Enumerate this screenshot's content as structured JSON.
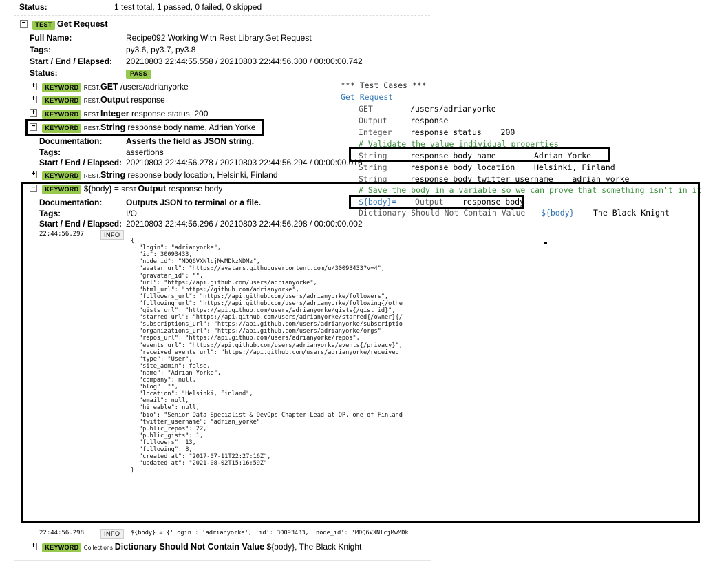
{
  "status_row": {
    "label": "Status:",
    "value": "1 test total, 1 passed, 0 failed, 0 skipped"
  },
  "test": {
    "badge": "TEST",
    "name": "Get Request",
    "full_name_label": "Full Name:",
    "full_name": "Recipe092 Working With Rest Library.Get Request",
    "tags_label": "Tags:",
    "tags": "py3.6, py3.7, py3.8",
    "elapsed_label": "Start / End / Elapsed:",
    "elapsed": "20210803 22:44:55.558 / 20210803 22:44:56.300 / 00:00:00.742",
    "status_label": "Status:",
    "status": "PASS"
  },
  "keywords": [
    {
      "badge": "KEYWORD",
      "lib": "REST.",
      "name": "GET",
      "args": " /users/adrianyorke",
      "toggle": "+"
    },
    {
      "badge": "KEYWORD",
      "lib": "REST.",
      "name": "Output",
      "args": " response",
      "toggle": "+"
    },
    {
      "badge": "KEYWORD",
      "lib": "REST.",
      "name": "Integer",
      "args": " response status, 200",
      "toggle": "+"
    },
    {
      "badge": "KEYWORD",
      "lib": "REST.",
      "name": "String",
      "args": " response body name, Adrian Yorke",
      "toggle": "−",
      "doc_label": "Documentation:",
      "doc": "Asserts the field as JSON string.",
      "tags_label": "Tags:",
      "tags": "assertions",
      "elapsed_label": "Start / End / Elapsed:",
      "elapsed": "20210803 22:44:56.278 / 20210803 22:44:56.294 / 00:00:00.016"
    },
    {
      "badge": "KEYWORD",
      "lib": "REST.",
      "name": "String",
      "args": " response body location, Helsinki, Finland",
      "toggle": "+"
    },
    {
      "badge": "KEYWORD",
      "prefix": "${body} = ",
      "lib": "REST.",
      "name": "Output",
      "args": " response body",
      "toggle": "−",
      "doc_label": "Documentation:",
      "doc": "Outputs JSON to terminal or a file.",
      "tags_label": "Tags:",
      "tags": "I/O",
      "elapsed_label": "Start / End / Elapsed:",
      "elapsed": "20210803 22:44:56.296 / 20210803 22:44:56.298 / 00:00:00.002"
    },
    {
      "badge": "KEYWORD",
      "lib": "Collections.",
      "name": "Dictionary Should Not Contain Value",
      "args": " ${body}, The Black Knight",
      "toggle": "+"
    }
  ],
  "log1": {
    "time": "22:44:56.297",
    "level": "INFO"
  },
  "json_lines": [
    "{",
    "    \"login\": \"adrianyorke\",",
    "    \"id\": 30093433,",
    "    \"node_id\": \"MDQ6VXNlcjMwMDkzNDMz\",",
    "    \"avatar_url\": \"https://avatars.githubusercontent.com/u/30093433?v=4\",",
    "    \"gravatar_id\": \"\",",
    "    \"url\": \"https://api.github.com/users/adrianyorke\",",
    "    \"html_url\": \"https://github.com/adrianyorke\",",
    "    \"followers_url\": \"https://api.github.com/users/adrianyorke/followers\",",
    "    \"following_url\": \"https://api.github.com/users/adrianyorke/following{/othe",
    "    \"gists_url\": \"https://api.github.com/users/adrianyorke/gists{/gist_id}\",",
    "    \"starred_url\": \"https://api.github.com/users/adrianyorke/starred{/owner}{/",
    "    \"subscriptions_url\": \"https://api.github.com/users/adrianyorke/subscriptio",
    "    \"organizations_url\": \"https://api.github.com/users/adrianyorke/orgs\",",
    "    \"repos_url\": \"https://api.github.com/users/adrianyorke/repos\",",
    "    \"events_url\": \"https://api.github.com/users/adrianyorke/events{/privacy}\",",
    "    \"received_events_url\": \"https://api.github.com/users/adrianyorke/received_",
    "    \"type\": \"User\",",
    "    \"site_admin\": false,",
    "    \"name\": \"Adrian Yorke\",",
    "    \"company\": null,",
    "    \"blog\": \"\",",
    "    \"location\": \"Helsinki, Finland\",",
    "    \"email\": null,",
    "    \"hireable\": null,",
    "    \"bio\": \"Senior Data Specialist & DevOps Chapter Lead at OP, one of Finland",
    "    \"twitter_username\": \"adrian_yorke\",",
    "    \"public_repos\": 22,",
    "    \"public_gists\": 1,",
    "    \"followers\": 13,",
    "    \"following\": 8,",
    "    \"created_at\": \"2017-07-11T22:27:16Z\",",
    "    \"updated_at\": \"2021-08-02T15:16:59Z\"",
    "}"
  ],
  "log2": {
    "time": "22:44:56.298",
    "level": "INFO",
    "message": "${body} = {'login': 'adrianyorke', 'id': 30093433, 'node_id': 'MDQ6VXNlcjMwMDk"
  },
  "code_panel": {
    "header": "*** Test Cases ***",
    "test_name": "Get Request",
    "lines": [
      {
        "kw": "GET",
        "args": "/users/adrianyorke"
      },
      {
        "kw": "Output",
        "args": "response"
      },
      {
        "kw": "Integer",
        "args": "response status    200"
      },
      {
        "comment": "# Validate the value individual properties"
      },
      {
        "kw": "String",
        "args": "response body name        Adrian Yorke"
      },
      {
        "kw": "String",
        "args": "response body location    Helsinki, Finland"
      },
      {
        "kw": "String",
        "args": "response body twitter username    adrian_yorke"
      },
      {
        "comment": "# Save the body in a variable so we can prove that something isn't in it"
      },
      {
        "var": "${body}=",
        "kw": "Output",
        "args": "response body"
      },
      {
        "kw": "Dictionary Should Not Contain Value",
        "var2": "${body}",
        "args": "The Black Knight"
      }
    ]
  }
}
